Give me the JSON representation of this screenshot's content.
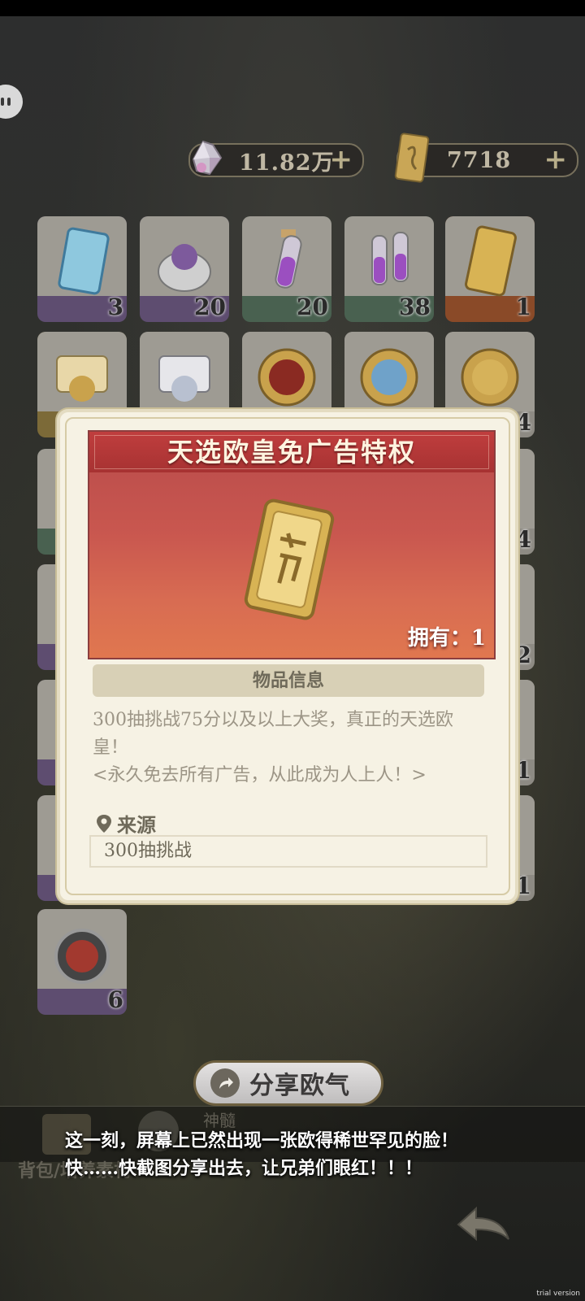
{
  "currency": {
    "gems": "11.82万",
    "tickets": "7718",
    "add_symbol": "+"
  },
  "inventory": {
    "row1_counts": [
      "3",
      "20",
      "20",
      "38",
      "1"
    ],
    "row2_right_count": "4",
    "partial_counts": [
      "4",
      "2",
      "1",
      "1"
    ],
    "last_item_count": "6"
  },
  "modal": {
    "title": "天选欧皇免广告特权",
    "owned_label": "拥有：1",
    "info_header": "物品信息",
    "description_line1": "300抽挑战75分以及以上大奖，真正的天选欧",
    "description_line2": "皇！",
    "description_line3": "<永久免去所有广告，从此成为人上人！>",
    "source_label": "来源",
    "source_value": "300抽挑战"
  },
  "share": {
    "label": "分享欧气"
  },
  "bottom": {
    "breadcrumb": "背包/培养素材",
    "tab_ghost": "神髓"
  },
  "toast": {
    "line1": "这一刻，屏幕上已然出现一张欧得稀世罕见的脸！",
    "line2": "快……快截图分享出去，让兄弟们眼红！！！"
  },
  "watermark": "trial version"
}
